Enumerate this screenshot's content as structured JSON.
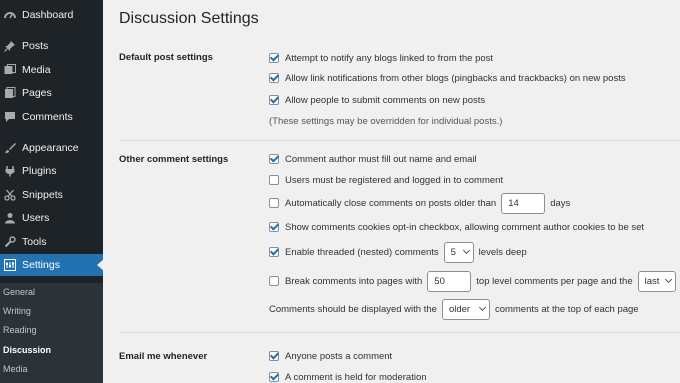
{
  "sidebar": {
    "items": [
      {
        "label": "Dashboard",
        "icon": "dashboard-icon"
      },
      {
        "label": "Posts",
        "icon": "pin-icon"
      },
      {
        "label": "Media",
        "icon": "media-icon"
      },
      {
        "label": "Pages",
        "icon": "pages-icon"
      },
      {
        "label": "Comments",
        "icon": "comments-icon"
      },
      {
        "label": "Appearance",
        "icon": "paintbrush-icon"
      },
      {
        "label": "Plugins",
        "icon": "plugins-icon"
      },
      {
        "label": "Snippets",
        "icon": "snippets-icon"
      },
      {
        "label": "Users",
        "icon": "users-icon"
      },
      {
        "label": "Tools",
        "icon": "tools-icon"
      },
      {
        "label": "Settings",
        "icon": "settings-icon"
      }
    ],
    "submenu": [
      "General",
      "Writing",
      "Reading",
      "Discussion",
      "Media"
    ],
    "active_color": "#2271b1"
  },
  "page": {
    "title": "Discussion Settings"
  },
  "default_post": {
    "label": "Default post settings",
    "opt1": "Attempt to notify any blogs linked to from the post",
    "opt2": "Allow link notifications from other blogs (pingbacks and trackbacks) on new posts",
    "opt3": "Allow people to submit comments on new posts",
    "note": "(These settings may be overridden for individual posts.)"
  },
  "other_comment": {
    "label": "Other comment settings",
    "opt1": "Comment author must fill out name and email",
    "opt2": "Users must be registered and logged in to comment",
    "opt3_pre": "Automatically close comments on posts older than",
    "opt3_value": "14",
    "opt3_post": "days",
    "opt4": "Show comments cookies opt-in checkbox, allowing comment author cookies to be set",
    "opt5_pre": "Enable threaded (nested) comments",
    "opt5_value": "5",
    "opt5_post": "levels deep",
    "opt6_pre": "Break comments into pages with",
    "opt6_value": "50",
    "opt6_mid": "top level comments per page and the",
    "opt6_select": "last",
    "opt7_pre": "Comments should be displayed with the",
    "opt7_select": "older",
    "opt7_post": "comments at the top of each page"
  },
  "email": {
    "label": "Email me whenever",
    "opt1": "Anyone posts a comment",
    "opt2": "A comment is held for moderation"
  }
}
